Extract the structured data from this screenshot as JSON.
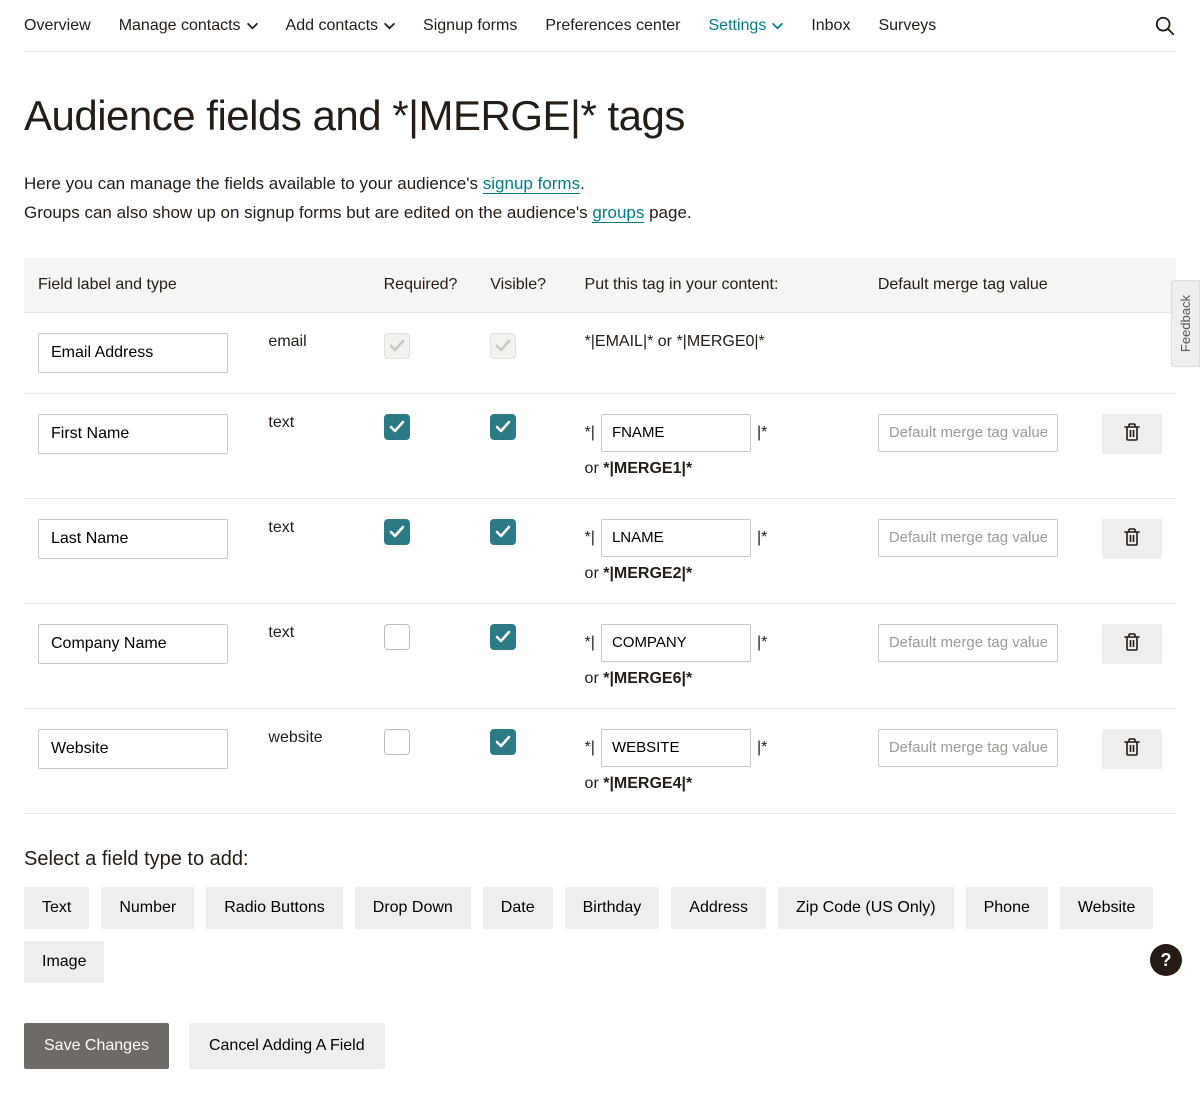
{
  "nav": {
    "items": [
      {
        "label": "Overview",
        "dropdown": false,
        "active": false
      },
      {
        "label": "Manage contacts",
        "dropdown": true,
        "active": false
      },
      {
        "label": "Add contacts",
        "dropdown": true,
        "active": false
      },
      {
        "label": "Signup forms",
        "dropdown": false,
        "active": false
      },
      {
        "label": "Preferences center",
        "dropdown": false,
        "active": false
      },
      {
        "label": "Settings",
        "dropdown": true,
        "active": true
      },
      {
        "label": "Inbox",
        "dropdown": false,
        "active": false
      },
      {
        "label": "Surveys",
        "dropdown": false,
        "active": false
      }
    ]
  },
  "title": "Audience fields and *|MERGE|* tags",
  "intro": {
    "line1a": "Here you can manage the fields available to your audience's ",
    "link1": "signup forms",
    "line1b": ".",
    "line2a": "Groups can also show up on signup forms but are edited on the audience's ",
    "link2": "groups",
    "line2b": " page."
  },
  "table": {
    "headers": {
      "label": "Field label and type",
      "required": "Required?",
      "visible": "Visible?",
      "tag": "Put this tag in your content:",
      "default": "Default merge tag value"
    },
    "default_placeholder": "Default merge tag value",
    "rows": [
      {
        "label": "Email Address",
        "type": "email",
        "required_checked": true,
        "required_disabled": true,
        "visible_checked": true,
        "visible_disabled": true,
        "tag_static": "*|EMAIL|* or *|MERGE0|*",
        "tag_input": null,
        "alt_tag": null,
        "show_default": false,
        "show_delete": false
      },
      {
        "label": "First Name",
        "type": "text",
        "required_checked": true,
        "required_disabled": false,
        "visible_checked": true,
        "visible_disabled": false,
        "tag_static": null,
        "tag_input": "FNAME",
        "alt_tag": "*|MERGE1|*",
        "show_default": true,
        "show_delete": true
      },
      {
        "label": "Last Name",
        "type": "text",
        "required_checked": true,
        "required_disabled": false,
        "visible_checked": true,
        "visible_disabled": false,
        "tag_static": null,
        "tag_input": "LNAME",
        "alt_tag": "*|MERGE2|*",
        "show_default": true,
        "show_delete": true
      },
      {
        "label": "Company Name",
        "type": "text",
        "required_checked": false,
        "required_disabled": false,
        "visible_checked": true,
        "visible_disabled": false,
        "tag_static": null,
        "tag_input": "COMPANY",
        "alt_tag": "*|MERGE6|*",
        "show_default": true,
        "show_delete": true
      },
      {
        "label": "Website",
        "type": "website",
        "required_checked": false,
        "required_disabled": false,
        "visible_checked": true,
        "visible_disabled": false,
        "tag_static": null,
        "tag_input": "WEBSITE",
        "alt_tag": "*|MERGE4|*",
        "show_default": true,
        "show_delete": true
      }
    ]
  },
  "add_section": {
    "heading": "Select a field type to add:",
    "types": [
      "Text",
      "Number",
      "Radio Buttons",
      "Drop Down",
      "Date",
      "Birthday",
      "Address",
      "Zip Code (US Only)",
      "Phone",
      "Website",
      "Image"
    ]
  },
  "actions": {
    "save": "Save Changes",
    "cancel": "Cancel Adding A Field"
  },
  "feedback_label": "Feedback",
  "help_label": "?",
  "tag_delims": {
    "open": "*|",
    "close": "|*",
    "or": "or "
  }
}
